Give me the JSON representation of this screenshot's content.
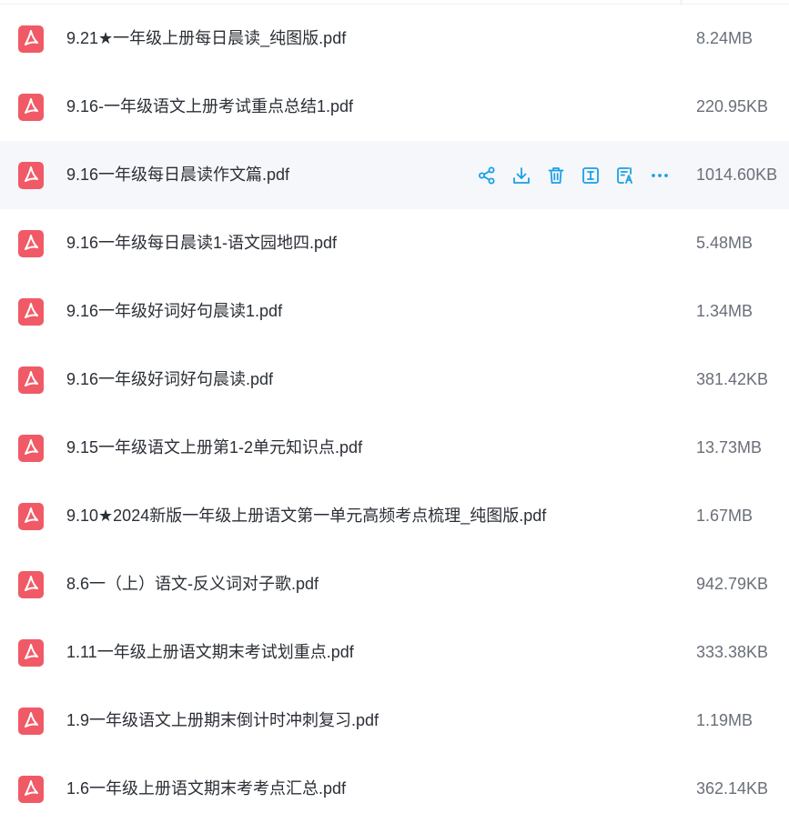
{
  "colors": {
    "pdf_icon": "#f05a66",
    "action_icon": "#1aa0e6",
    "hover_row": "#f5f7fb",
    "name_text": "#2b2f36",
    "size_text": "#6a6f78"
  },
  "row_actions": [
    "share-icon",
    "download-icon",
    "delete-icon",
    "rename-icon",
    "copy-icon",
    "more-icon"
  ],
  "files": [
    {
      "name": "9.21★一年级上册每日晨读_纯图版.pdf",
      "size": "8.24MB"
    },
    {
      "name": "9.16-一年级语文上册考试重点总结1.pdf",
      "size": "220.95KB"
    },
    {
      "name": "9.16一年级每日晨读作文篇.pdf",
      "size": "1014.60KB"
    },
    {
      "name": "9.16一年级每日晨读1-语文园地四.pdf",
      "size": "5.48MB"
    },
    {
      "name": "9.16一年级好词好句晨读1.pdf",
      "size": "1.34MB"
    },
    {
      "name": "9.16一年级好词好句晨读.pdf",
      "size": "381.42KB"
    },
    {
      "name": "9.15一年级语文上册第1-2单元知识点.pdf",
      "size": "13.73MB"
    },
    {
      "name": "9.10★2024新版一年级上册语文第一单元高频考点梳理_纯图版.pdf",
      "size": "1.67MB"
    },
    {
      "name": "8.6一（上）语文-反义词对子歌.pdf",
      "size": "942.79KB"
    },
    {
      "name": "1.11一年级上册语文期末考试划重点.pdf",
      "size": "333.38KB"
    },
    {
      "name": "1.9一年级语文上册期末倒计时冲刺复习.pdf",
      "size": "1.19MB"
    },
    {
      "name": "1.6一年级上册语文期末考考点汇总.pdf",
      "size": "362.14KB"
    }
  ]
}
